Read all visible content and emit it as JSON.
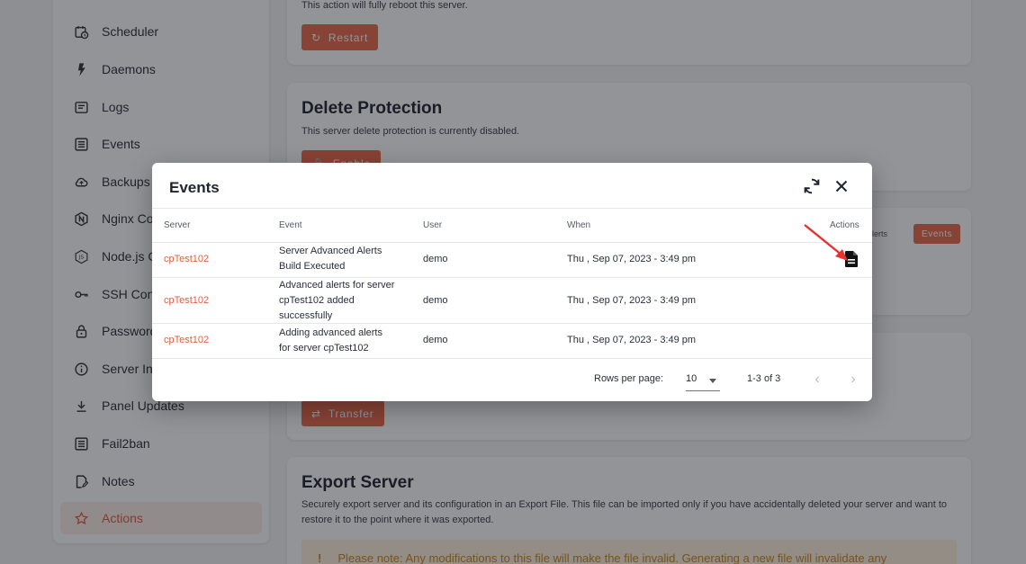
{
  "sidebar": {
    "items": [
      {
        "label": "Scheduler",
        "icon": "calendar-clock-icon"
      },
      {
        "label": "Daemons",
        "icon": "bolt-icon"
      },
      {
        "label": "Logs",
        "icon": "log-list-icon"
      },
      {
        "label": "Events",
        "icon": "event-list-icon"
      },
      {
        "label": "Backups",
        "icon": "cloud-backup-icon"
      },
      {
        "label": "Nginx Configuration",
        "icon": "nginx-icon"
      },
      {
        "label": "Node.js Configuration",
        "icon": "nodejs-icon"
      },
      {
        "label": "SSH Configuration",
        "icon": "key-icon"
      },
      {
        "label": "Password Reset",
        "icon": "lock-icon"
      },
      {
        "label": "Server Information",
        "icon": "info-icon"
      },
      {
        "label": "Panel Updates",
        "icon": "download-icon"
      },
      {
        "label": "Fail2ban",
        "icon": "list-box-icon"
      },
      {
        "label": "Notes",
        "icon": "note-edit-icon"
      },
      {
        "label": "Actions",
        "icon": "star-icon"
      }
    ],
    "active_item": "Actions"
  },
  "cards": {
    "restart": {
      "text": "This action will fully reboot this server.",
      "button": "Restart"
    },
    "delete_protection": {
      "title": "Delete Protection",
      "text": "This server delete protection is currently disabled.",
      "button": "Enable"
    },
    "events_card": {
      "side_text": "_alerts",
      "button": "Events"
    },
    "transfer": {
      "button": "Transfer"
    },
    "export": {
      "title": "Export Server",
      "text": "Securely export server and its configuration in an Export File. This file can be imported only if you have accidentally deleted your server and want to restore it to the point where it was exported.",
      "note": "Please note: Any modifications to this file will make the file invalid. Generating a new file will invalidate any"
    }
  },
  "modal": {
    "title": "Events",
    "columns": {
      "server": "Server",
      "event": "Event",
      "user": "User",
      "when": "When",
      "actions": "Actions"
    },
    "rows": [
      {
        "server": "cpTest102",
        "event_l1": "Server Advanced Alerts",
        "event_l2": "Build Executed",
        "event_l3": "",
        "user": "demo",
        "when": "Thu , Sep 07, 2023 - 3:49 pm"
      },
      {
        "server": "cpTest102",
        "event_l1": "Advanced alerts for server",
        "event_l2": "cpTest102 added",
        "event_l3": "successfully",
        "user": "demo",
        "when": "Thu , Sep 07, 2023 - 3:49 pm"
      },
      {
        "server": "cpTest102",
        "event_l1": "Adding advanced alerts",
        "event_l2": "for server cpTest102",
        "event_l3": "",
        "user": "demo",
        "when": "Thu , Sep 07, 2023 - 3:49 pm"
      }
    ],
    "footer": {
      "rows_per_page_label": "Rows per page:",
      "rows_per_page": "10",
      "range": "1-3 of 3"
    }
  },
  "colors": {
    "accent": "#e9694a",
    "accent_text": "#e35d3d",
    "annotation_arrow": "#e8322f"
  }
}
